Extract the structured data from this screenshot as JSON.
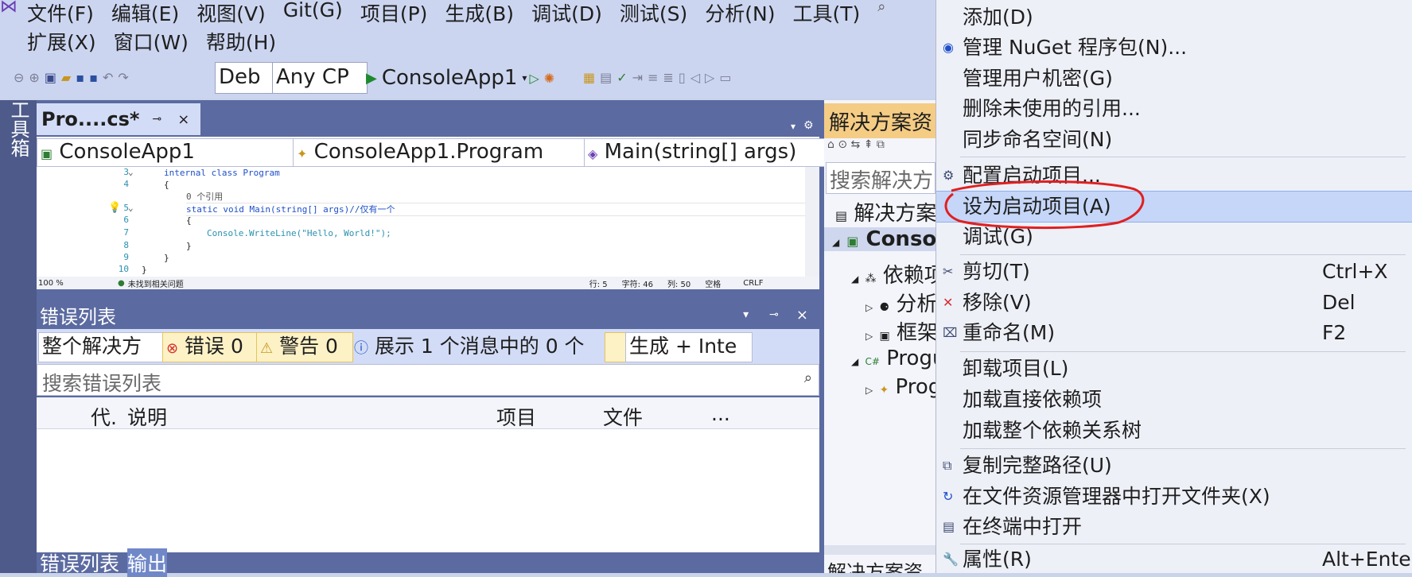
{
  "menubar": {
    "row1": [
      "文件(F)",
      "编辑(E)",
      "视图(V)",
      "Git(G)",
      "项目(P)",
      "生成(B)",
      "调试(D)",
      "测试(S)",
      "分析(N)",
      "工具(T)"
    ],
    "row2": [
      "扩展(X)",
      "窗口(W)",
      "帮助(H)"
    ]
  },
  "toolbar": {
    "config": "Deb",
    "platform": "Any CP",
    "start_label": "ConsoleApp1"
  },
  "toolbox": {
    "label": "工具箱"
  },
  "doc_tab": {
    "title": "Pro....cs*",
    "pin": "⊸",
    "close": "×"
  },
  "navbar": {
    "project": "ConsoleApp1",
    "class": "ConsoleApp1.Program",
    "member": "Main(string[] args)"
  },
  "code": {
    "lines": [
      {
        "num": "3",
        "text": "internal class Program"
      },
      {
        "num": "4",
        "text": "{"
      },
      {
        "num": "",
        "text": "0 个引用"
      },
      {
        "num": "5",
        "text": "static void Main(string[] args)//仅有一个"
      },
      {
        "num": "6",
        "text": "{"
      },
      {
        "num": "7",
        "text": "Console.WriteLine(\"Hello, World!\");"
      },
      {
        "num": "8",
        "text": "}"
      },
      {
        "num": "9",
        "text": "}"
      },
      {
        "num": "10",
        "text": "}"
      }
    ]
  },
  "editor_status": {
    "zoom": "100 %",
    "issues": "未找到相关问题",
    "line": "行: 5",
    "char": "字符: 46",
    "col": "列: 50",
    "spaces": "空格",
    "eol": "CRLF"
  },
  "error_list": {
    "title": "错误列表",
    "scope": "整个解决方",
    "errors": "错误 0",
    "warnings": "警告 0",
    "messages": "展示 1 个消息中的 0 个",
    "build": "生成 + Inte",
    "search_placeholder": "搜索错误列表",
    "columns": [
      "代.",
      "说明",
      "项目",
      "文件",
      "..."
    ]
  },
  "bottom_tabs": [
    "错误列表",
    "输出"
  ],
  "solution_explorer": {
    "title": "解决方案资",
    "search_placeholder": "搜索解决方",
    "items": [
      "解决方案",
      "Conso",
      "依赖项",
      "分析",
      "框架",
      "Progu",
      "Prog"
    ],
    "footer": "解决方案资"
  },
  "context_menu": {
    "items": [
      {
        "label": "添加(D)",
        "shortcut": ""
      },
      {
        "label": "管理 NuGet 程序包(N)...",
        "shortcut": ""
      },
      {
        "label": "管理用户机密(G)",
        "shortcut": ""
      },
      {
        "label": "删除未使用的引用...",
        "shortcut": ""
      },
      {
        "label": "同步命名空间(N)",
        "shortcut": ""
      },
      {
        "label": "配置启动项目...",
        "shortcut": ""
      },
      {
        "label": "设为启动项目(A)",
        "shortcut": ""
      },
      {
        "label": "调试(G)",
        "shortcut": ""
      },
      {
        "label": "剪切(T)",
        "shortcut": "Ctrl+X"
      },
      {
        "label": "移除(V)",
        "shortcut": "Del"
      },
      {
        "label": "重命名(M)",
        "shortcut": "F2"
      },
      {
        "label": "卸载项目(L)",
        "shortcut": ""
      },
      {
        "label": "加载直接依赖项",
        "shortcut": ""
      },
      {
        "label": "加载整个依赖关系树",
        "shortcut": ""
      },
      {
        "label": "复制完整路径(U)",
        "shortcut": ""
      },
      {
        "label": "在文件资源管理器中打开文件夹(X)",
        "shortcut": ""
      },
      {
        "label": "在终端中打开",
        "shortcut": ""
      },
      {
        "label": "属性(R)",
        "shortcut": "Alt+Ente"
      }
    ]
  },
  "colors": {
    "accent_highlight": "#c5d6f8",
    "annotation_red": "#e02020",
    "title_bar": "#5b6aa0"
  }
}
